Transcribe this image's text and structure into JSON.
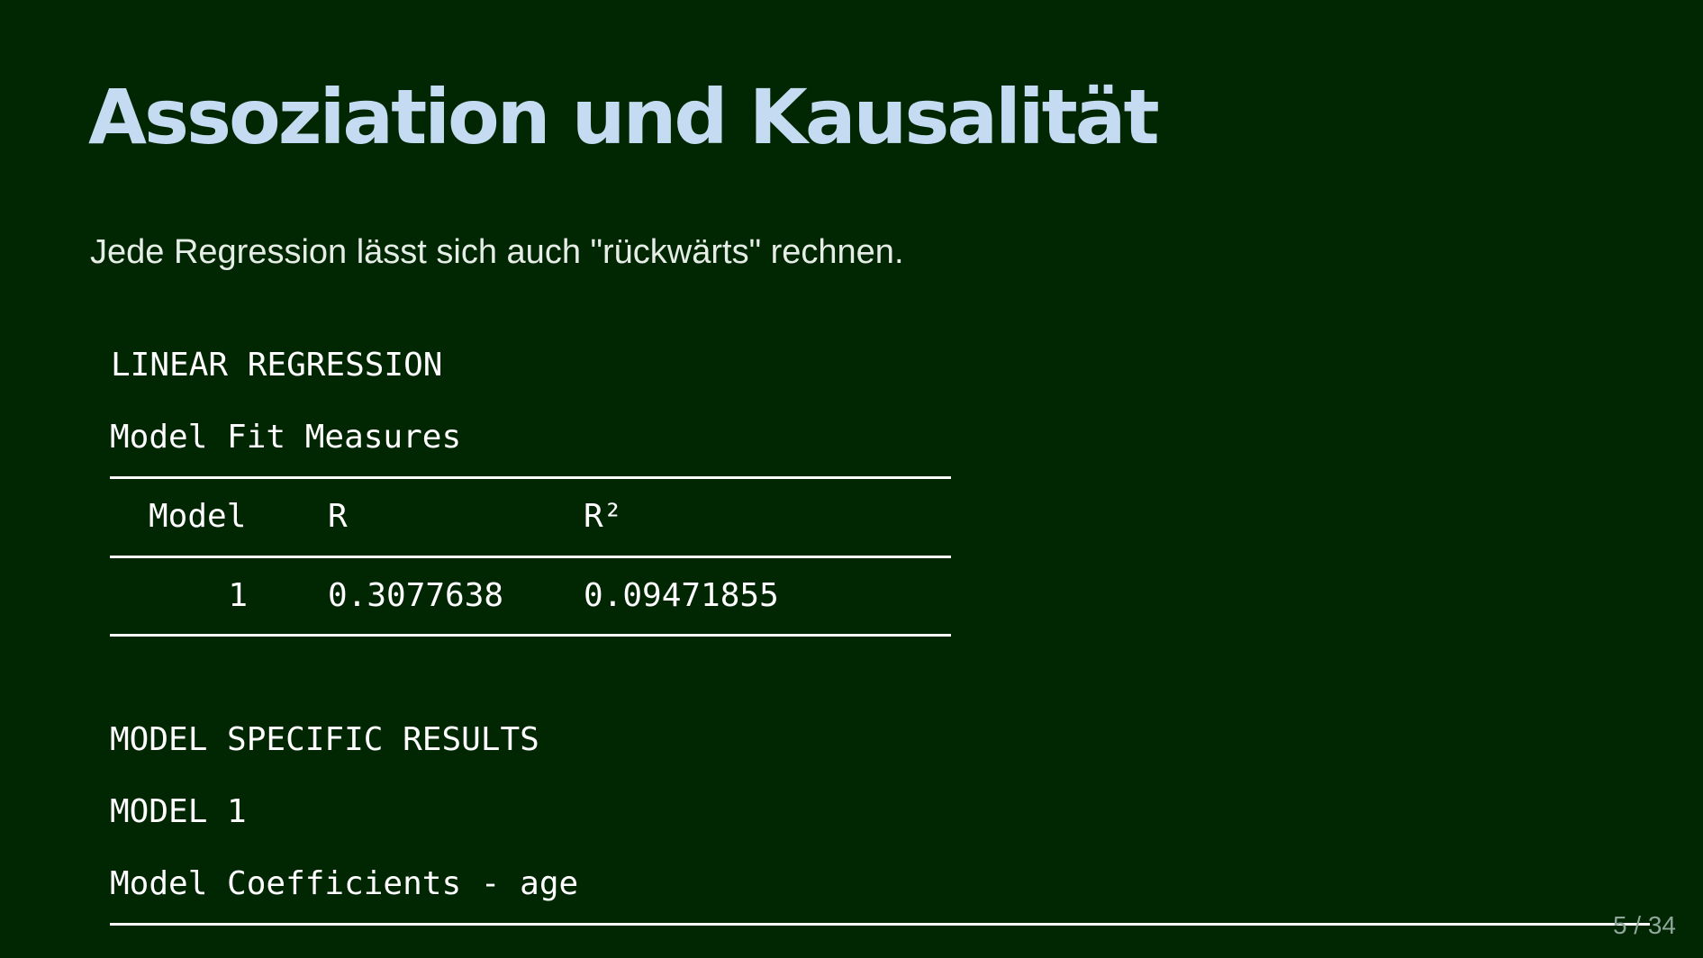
{
  "slide": {
    "title": "Assoziation und Kausalität",
    "subtitle": "Jede Regression lässt sich auch \"rückwärts\" rechnen.",
    "page_number": "5 / 34"
  },
  "output": {
    "heading": "LINEAR REGRESSION",
    "fit_table": {
      "caption": "Model Fit Measures",
      "columns": [
        "Model",
        "R",
        "R²"
      ],
      "rows": [
        [
          "1",
          "0.3077638",
          "0.09471855"
        ]
      ]
    },
    "specific_heading": "MODEL SPECIFIC RESULTS",
    "model_label": "MODEL 1",
    "coef_caption": "Model Coefficients - age"
  }
}
